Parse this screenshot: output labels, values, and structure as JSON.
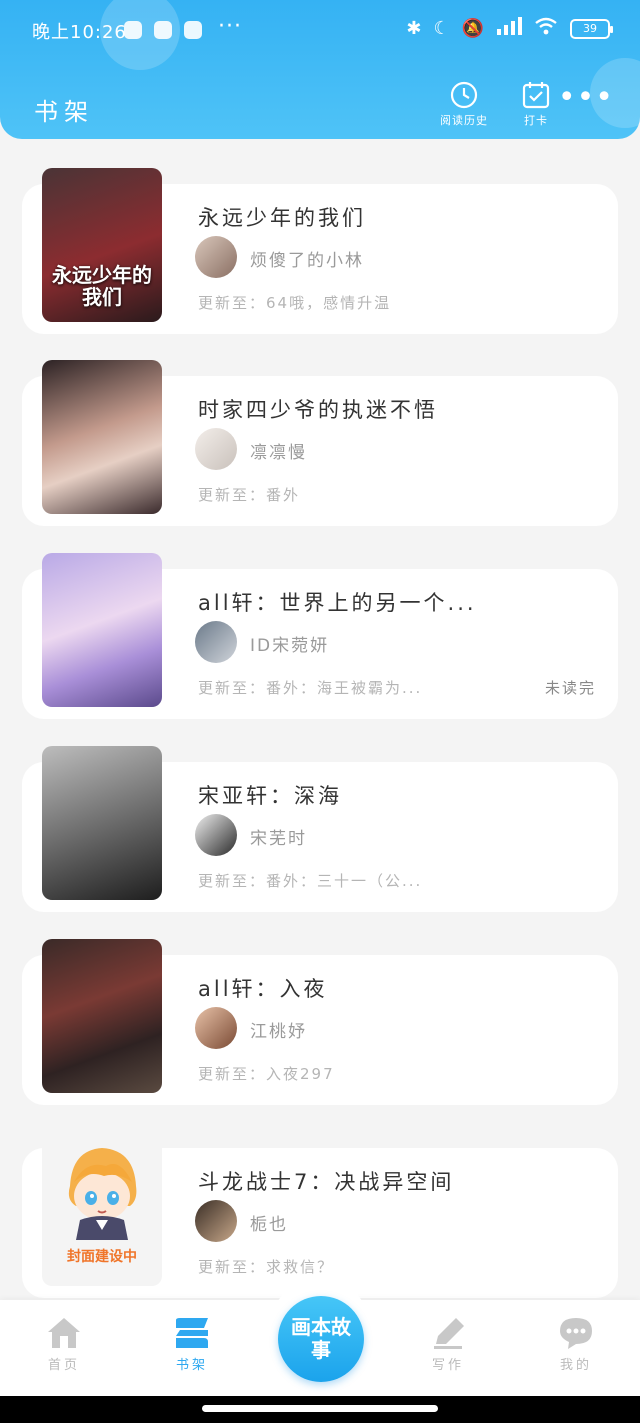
{
  "status_bar": {
    "time": "晚上10:26",
    "battery": "39"
  },
  "header": {
    "title": "书架",
    "history_label": "阅读历史",
    "checkin_label": "打卡"
  },
  "books": [
    {
      "title": "永远少年的我们",
      "cover_text": "永远少年的我们",
      "author": "烦傻了的小林",
      "update": "更新至：64哦，感情升温",
      "status": ""
    },
    {
      "title": "时家四少爷的执迷不悟",
      "cover_text": "",
      "author": "凛凛慢",
      "update": "更新至：番外",
      "status": ""
    },
    {
      "title": "all轩：世界上的另一个...",
      "cover_text": "",
      "author": "ID宋菀妍",
      "update": "更新至：番外：海王被霸为...",
      "status": "未读完"
    },
    {
      "title": "宋亚轩：深海",
      "cover_text": "",
      "author": "宋芜时",
      "update": "更新至：番外：三十一（公...",
      "status": ""
    },
    {
      "title": "all轩：入夜",
      "cover_text": "",
      "author": "江桃妤",
      "update": "更新至：入夜297",
      "status": ""
    },
    {
      "title": "斗龙战士7：决战异空间",
      "cover_text": "封面建设中",
      "author": "栀也",
      "update": "更新至：求救信？",
      "status": ""
    }
  ],
  "nav": {
    "home": "首页",
    "bookshelf": "书架",
    "fab": "画本故事",
    "write": "写作",
    "mine": "我的"
  },
  "colors": {
    "primary": "#35b2f3",
    "active_tab": "#2ea8f0"
  }
}
